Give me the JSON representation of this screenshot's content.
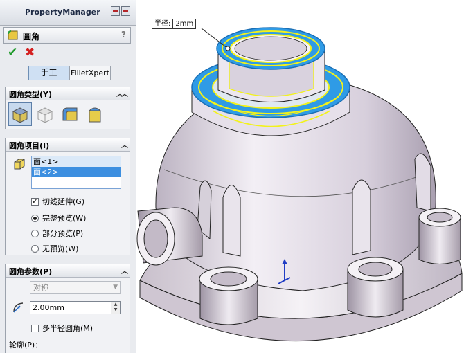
{
  "panel": {
    "title": "PropertyManager",
    "feature_name": "圆角",
    "help": "?",
    "ok_symbol": "✔",
    "cancel_symbol": "✖",
    "modes": {
      "manual": "手工",
      "expert": "FilletXpert"
    }
  },
  "fillet_type": {
    "title": "圆角类型(Y)",
    "options": [
      "constant-size-icon",
      "variable-size-icon",
      "face-fillet-icon",
      "full-round-icon"
    ],
    "selected_index": 0
  },
  "fillet_items": {
    "title": "圆角项目(I)",
    "faces": [
      "面<1>",
      "面<2>"
    ],
    "selected_index": 1,
    "tangent_propagation": "切线延伸(G)",
    "tangent_checked": true,
    "preview_options": [
      "完整预览(W)",
      "部分预览(P)",
      "无预览(W)"
    ],
    "preview_selected": 0
  },
  "fillet_params": {
    "title": "圆角参数(P)",
    "method": "对称",
    "radius": "2.00mm",
    "multi_radius": "多半径圆角(M)",
    "multi_radius_checked": false,
    "profile": "轮廓(P)："
  },
  "viewport": {
    "callout_label": "半径:",
    "callout_value": "2mm",
    "highlight_color": "#f2f21a",
    "selection_color": "#2f9be6"
  }
}
